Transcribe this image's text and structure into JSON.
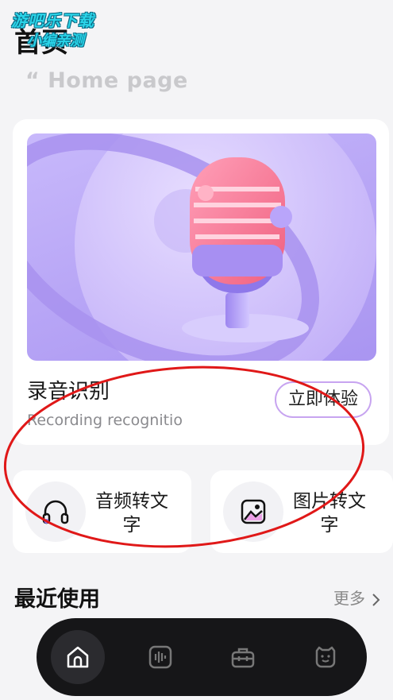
{
  "watermark": {
    "line1": "游吧乐下载",
    "line2": "小编亲测"
  },
  "header": {
    "title": "首页",
    "subtitle": "“ Home page"
  },
  "feature": {
    "title": "录音识别",
    "subtitle": "Recording recognitio",
    "button_label": "立即体验",
    "image_icon": "microphone-illustration"
  },
  "tiles": [
    {
      "label": "音频转文字",
      "icon": "headphones-icon"
    },
    {
      "label": "图片转文字",
      "icon": "picture-icon"
    }
  ],
  "recent": {
    "title": "最近使用",
    "more_label": "更多"
  },
  "nav": {
    "items": [
      {
        "icon": "home-icon",
        "active": true
      },
      {
        "icon": "audio-wave-icon",
        "active": false
      },
      {
        "icon": "toolbox-icon",
        "active": false
      },
      {
        "icon": "smiley-face-icon",
        "active": false
      }
    ]
  },
  "colors": {
    "accent_border": "#c7a4f0",
    "nav_bg": "#161618",
    "annotation": "#e01818"
  }
}
